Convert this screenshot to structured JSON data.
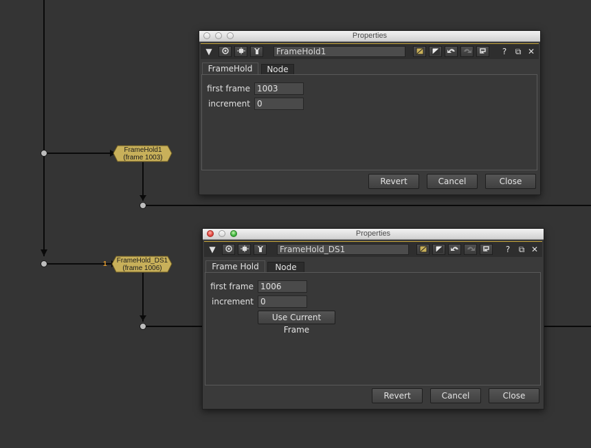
{
  "node_graph": {
    "node1": {
      "name": "FrameHold1",
      "frame": "(frame 1003)"
    },
    "node2": {
      "name": "FrameHold_DS1",
      "frame": "(frame 1006)",
      "badge": "1"
    }
  },
  "panel1": {
    "window_title": "Properties",
    "node_name": "FrameHold1",
    "tabs": [
      "FrameHold",
      "Node"
    ],
    "fields": {
      "first_frame_label": "first frame",
      "first_frame_value": "1003",
      "increment_label": "increment",
      "increment_value": "0"
    },
    "buttons": {
      "revert": "Revert",
      "cancel": "Cancel",
      "close": "Close"
    }
  },
  "panel2": {
    "window_title": "Properties",
    "node_name": "FrameHold_DS1",
    "tabs": [
      "Frame Hold",
      "Node"
    ],
    "fields": {
      "first_frame_label": "first frame",
      "first_frame_value": "1006",
      "increment_label": "increment",
      "increment_value": "0",
      "use_current_frame": "Use Current Frame"
    },
    "buttons": {
      "revert": "Revert",
      "cancel": "Cancel",
      "close": "Close"
    }
  },
  "toolbar_glyphs": {
    "collapse": "▼",
    "help": "?",
    "float": "⧉",
    "close": "✕"
  },
  "colors": {
    "background": "#343434",
    "node_fill": "#c8b05a",
    "accent_gold": "#c9a73a",
    "badge": "#e39a2b"
  }
}
